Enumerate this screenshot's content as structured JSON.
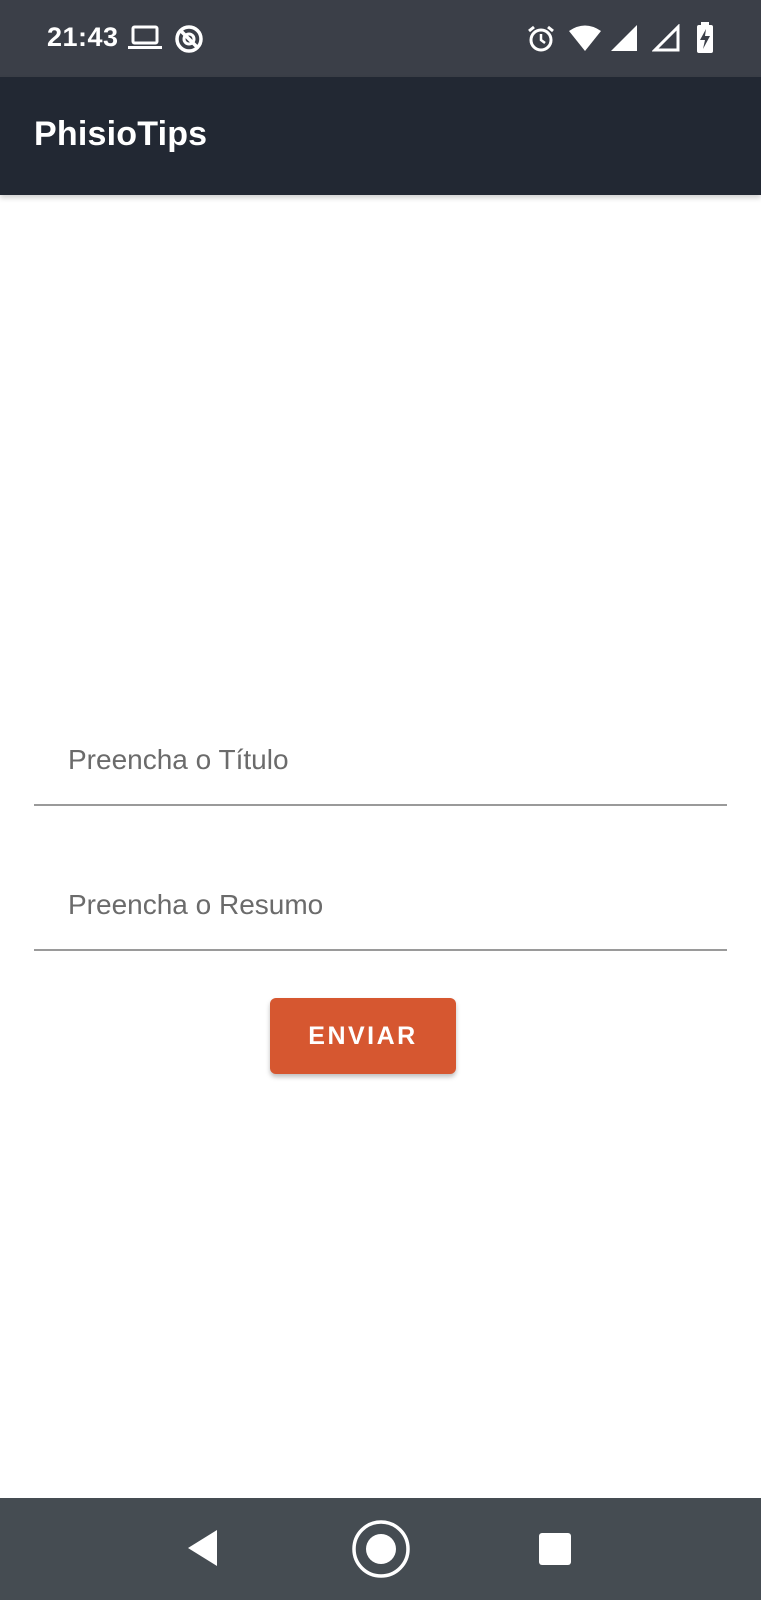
{
  "status_bar": {
    "time": "21:43",
    "left_icons": [
      "laptop-icon",
      "do-not-disturb-icon"
    ],
    "right_icons": [
      "alarm-icon",
      "wifi-icon",
      "signal-icon",
      "signal-empty-icon",
      "battery-charging-icon"
    ]
  },
  "app_bar": {
    "title": "PhisioTips"
  },
  "form": {
    "title_field": {
      "placeholder": "Preencha o Título",
      "value": ""
    },
    "summary_field": {
      "placeholder": "Preencha o Resumo",
      "value": ""
    },
    "submit_label": "ENVIAR"
  },
  "nav_bar": {
    "buttons": [
      "back-icon",
      "home-icon",
      "recents-icon"
    ]
  },
  "colors": {
    "status_bar": "#3b3f48",
    "app_bar": "#222833",
    "accent": "#d65730",
    "nav_bar": "#454c52"
  }
}
